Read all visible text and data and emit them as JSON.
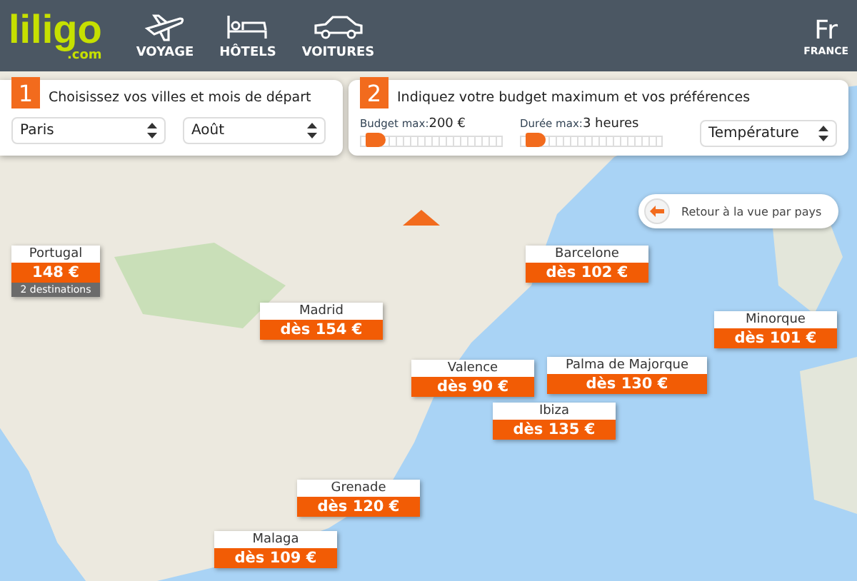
{
  "header": {
    "logo": "liligo",
    "logo_suffix": ".com",
    "nav": [
      {
        "kind": "plane",
        "label": "VOYAGE"
      },
      {
        "kind": "bed",
        "label": "HÔTELS"
      },
      {
        "kind": "car",
        "label": "VOITURES"
      }
    ],
    "language": "Fr",
    "country": "FRANCE"
  },
  "step1": {
    "number": "1",
    "title": "Choisissez vos villes et mois de départ",
    "city": "Paris",
    "month": "Août"
  },
  "step2": {
    "number": "2",
    "title": "Indiquez votre budget maximum et vos préférences",
    "sliders": [
      {
        "label": "Budget max:",
        "value": "200 €",
        "level": 0.03
      },
      {
        "label": "Durée max:",
        "value": "3 heures",
        "level": 0.03
      }
    ],
    "sort": "Température"
  },
  "back_button": "Retour à la vue par pays",
  "markers": [
    {
      "name": "Portugal",
      "price": "148 €",
      "note": "2 destinations"
    },
    {
      "name": "Madrid",
      "price": "dès 154 €"
    },
    {
      "name": "Barcelone",
      "price": "dès 102 €"
    },
    {
      "name": "Valence",
      "price": "dès 90 €"
    },
    {
      "name": "Minorque",
      "price": "dès 101 €"
    },
    {
      "name": "Palma de Majorque",
      "price": "dès 130 €"
    },
    {
      "name": "Ibiza",
      "price": "dès 135 €"
    },
    {
      "name": "Grenade",
      "price": "dès 120 €"
    },
    {
      "name": "Malaga",
      "price": "dès 109 €"
    }
  ]
}
